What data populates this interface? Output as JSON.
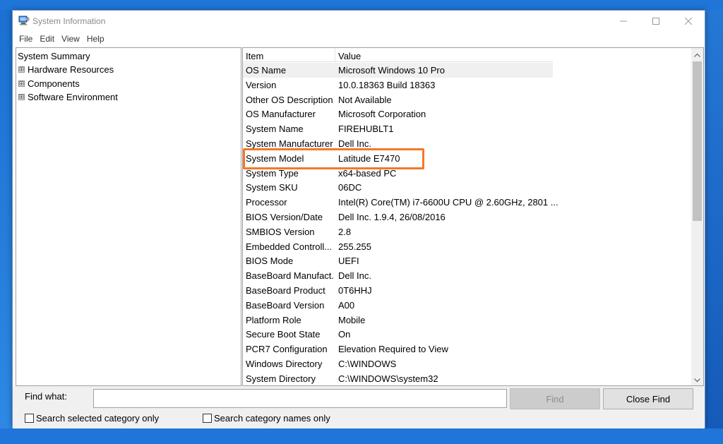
{
  "window": {
    "title": "System Information",
    "controls": {
      "minimize_icon": "minimize-icon",
      "maximize_icon": "maximize-icon",
      "close_icon": "close-icon"
    }
  },
  "menu": [
    "File",
    "Edit",
    "View",
    "Help"
  ],
  "tree": {
    "root": "System Summary",
    "children": [
      "Hardware Resources",
      "Components",
      "Software Environment"
    ],
    "expander_glyph": "⊞"
  },
  "list": {
    "headers": {
      "item": "Item",
      "value": "Value"
    },
    "rows": [
      {
        "item": "OS Name",
        "value": "Microsoft Windows 10 Pro"
      },
      {
        "item": "Version",
        "value": "10.0.18363 Build 18363"
      },
      {
        "item": "Other OS Description",
        "value": "Not Available"
      },
      {
        "item": "OS Manufacturer",
        "value": "Microsoft Corporation"
      },
      {
        "item": "System Name",
        "value": "FIREHUBLT1"
      },
      {
        "item": "System Manufacturer",
        "value": "Dell Inc."
      },
      {
        "item": "System Model",
        "value": "Latitude E7470"
      },
      {
        "item": "System Type",
        "value": "x64-based PC"
      },
      {
        "item": "System SKU",
        "value": "06DC"
      },
      {
        "item": "Processor",
        "value": "Intel(R) Core(TM) i7-6600U CPU @ 2.60GHz, 2801 ..."
      },
      {
        "item": "BIOS Version/Date",
        "value": "Dell Inc. 1.9.4, 26/08/2016"
      },
      {
        "item": "SMBIOS Version",
        "value": "2.8"
      },
      {
        "item": "Embedded Controll...",
        "value": "255.255"
      },
      {
        "item": "BIOS Mode",
        "value": "UEFI"
      },
      {
        "item": "BaseBoard Manufact...",
        "value": "Dell Inc."
      },
      {
        "item": "BaseBoard Product",
        "value": "0T6HHJ"
      },
      {
        "item": "BaseBoard Version",
        "value": "A00"
      },
      {
        "item": "Platform Role",
        "value": "Mobile"
      },
      {
        "item": "Secure Boot State",
        "value": "On"
      },
      {
        "item": "PCR7 Configuration",
        "value": "Elevation Required to View"
      },
      {
        "item": "Windows Directory",
        "value": "C:\\WINDOWS"
      },
      {
        "item": "System Directory",
        "value": "C:\\WINDOWS\\system32"
      }
    ],
    "selected_row": "OS Name",
    "highlighted_row": "System Model",
    "highlight_color": "#f2792a"
  },
  "find": {
    "label": "Find what:",
    "value": "",
    "find_button": "Find",
    "close_find_button": "Close Find",
    "check_selected_category": "Search selected category only",
    "check_category_names": "Search category names only"
  }
}
